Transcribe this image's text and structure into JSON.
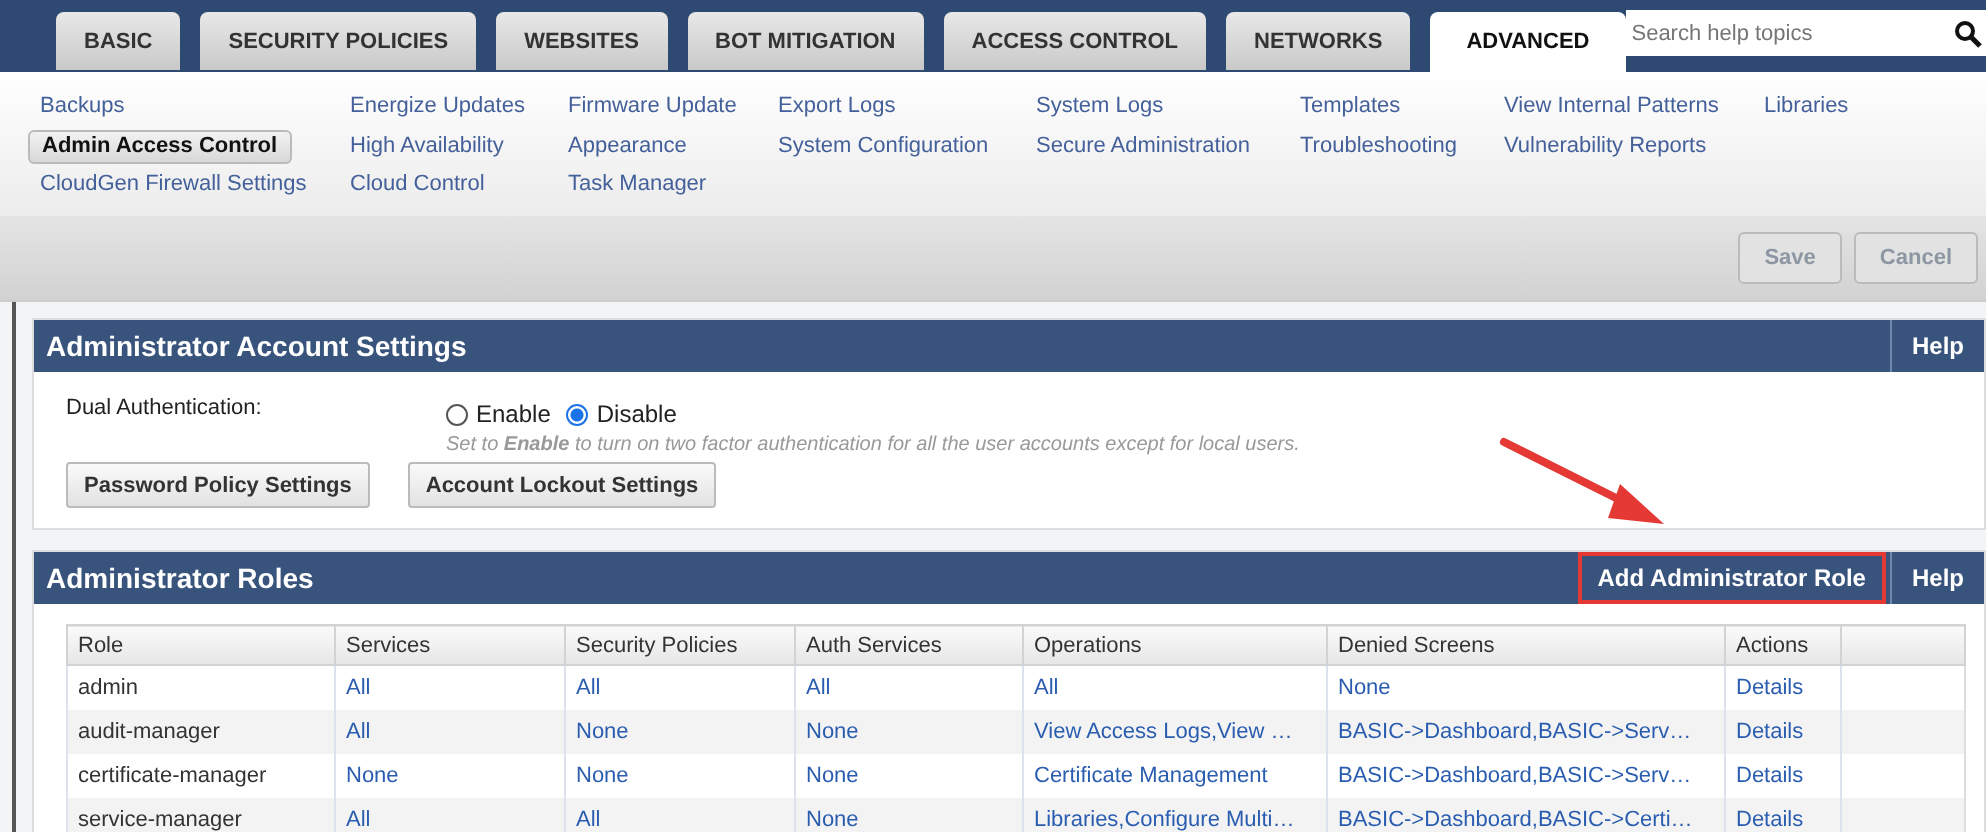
{
  "tabs": [
    {
      "label": "BASIC",
      "selected": false
    },
    {
      "label": "SECURITY POLICIES",
      "selected": false
    },
    {
      "label": "WEBSITES",
      "selected": false
    },
    {
      "label": "BOT MITIGATION",
      "selected": false
    },
    {
      "label": "ACCESS CONTROL",
      "selected": false
    },
    {
      "label": "NETWORKS",
      "selected": false
    },
    {
      "label": "ADVANCED",
      "selected": true
    }
  ],
  "search": {
    "placeholder": "Search help topics"
  },
  "subnav": [
    [
      {
        "label": "Backups",
        "selected": false
      },
      {
        "label": "Admin Access Control",
        "selected": true
      },
      {
        "label": "CloudGen Firewall Settings",
        "selected": false
      }
    ],
    [
      {
        "label": "Energize Updates",
        "selected": false
      },
      {
        "label": "High Availability",
        "selected": false
      },
      {
        "label": "Cloud Control",
        "selected": false
      }
    ],
    [
      {
        "label": "Firmware Update",
        "selected": false
      },
      {
        "label": "Appearance",
        "selected": false
      },
      {
        "label": "Task Manager",
        "selected": false
      }
    ],
    [
      {
        "label": "Export Logs",
        "selected": false
      },
      {
        "label": "System Configuration",
        "selected": false
      }
    ],
    [
      {
        "label": "System Logs",
        "selected": false
      },
      {
        "label": "Secure Administration",
        "selected": false
      }
    ],
    [
      {
        "label": "Templates",
        "selected": false
      },
      {
        "label": "Troubleshooting",
        "selected": false
      }
    ],
    [
      {
        "label": "View Internal Patterns",
        "selected": false
      },
      {
        "label": "Vulnerability Reports",
        "selected": false
      }
    ],
    [
      {
        "label": "Libraries",
        "selected": false
      }
    ]
  ],
  "toolbar": [
    {
      "label": "Save",
      "disabled": true
    },
    {
      "label": "Cancel",
      "disabled": true
    }
  ],
  "account_settings": {
    "title": "Administrator Account Settings",
    "help": "Help",
    "field_label": "Dual Authentication:",
    "options": [
      {
        "label": "Enable",
        "selected": false
      },
      {
        "label": "Disable",
        "selected": true
      }
    ],
    "hint": "Set to **Enable** to turn on two factor authentication for all the user accounts except for local users.",
    "buttons": [
      "Password Policy Settings",
      "Account Lockout Settings"
    ]
  },
  "roles": {
    "title": "Administrator Roles",
    "add_button": {
      "label": "Add Administrator Role",
      "highlighted": true
    },
    "help": "Help",
    "columns": [
      "Role",
      "Services",
      "Security Policies",
      "Auth Services",
      "Operations",
      "Denied Screens",
      "Actions"
    ],
    "rows": [
      [
        "admin",
        "All",
        "All",
        "All",
        "All",
        "None",
        "Details"
      ],
      [
        "audit-manager",
        "All",
        "None",
        "None",
        "View Access Logs,View …",
        "BASIC->Dashboard,BASIC->Serv…",
        "Details"
      ],
      [
        "certificate-manager",
        "None",
        "None",
        "None",
        "Certificate Management",
        "BASIC->Dashboard,BASIC->Serv…",
        "Details"
      ],
      [
        "service-manager",
        "All",
        "All",
        "None",
        "Libraries,Configure Multi…",
        "BASIC->Dashboard,BASIC->Certi…",
        "Details"
      ]
    ]
  }
}
